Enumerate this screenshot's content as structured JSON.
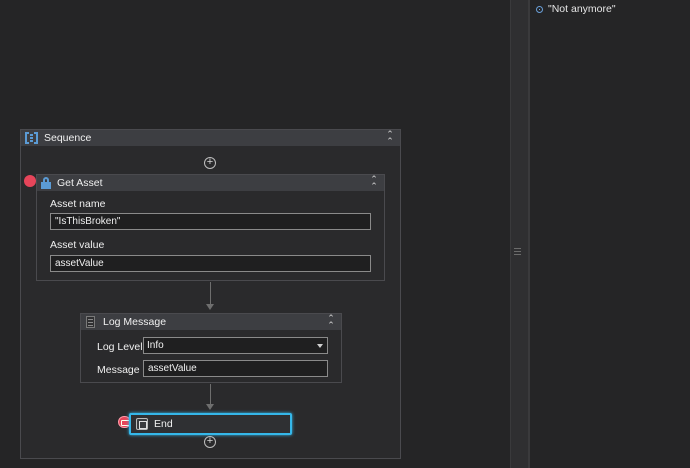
{
  "sequence": {
    "title": "Sequence"
  },
  "get_asset": {
    "title": "Get Asset",
    "asset_name_label": "Asset name",
    "asset_name_value": "\"IsThisBroken\"",
    "asset_value_label": "Asset value",
    "asset_value_value": "assetValue"
  },
  "log_message": {
    "title": "Log Message",
    "log_level_label": "Log Level",
    "log_level_value": "Info",
    "message_label": "Message",
    "message_value": "assetValue"
  },
  "end": {
    "title": "End"
  },
  "properties_panel": {
    "value_text": "\"Not anymore\""
  },
  "colors": {
    "canvas_bg": "#252526",
    "header_bg": "#3d3e42",
    "selection_accent": "#35b7ea",
    "breakpoint": "#e6455a",
    "icon_blue": "#5b9bd5"
  }
}
